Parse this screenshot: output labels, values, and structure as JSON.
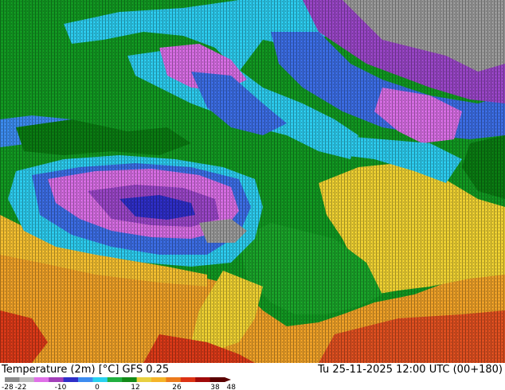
{
  "legend": {
    "title": "Temperature (2m) [°C] GFS 0.25",
    "run_time": "Tu 25-11-2025 12:00 UTC (00+180)",
    "ticks": [
      "-28",
      "-22",
      "-10",
      "0",
      "12",
      "26",
      "38",
      "48"
    ],
    "colors": [
      "#8c8c8c",
      "#bdbdbd",
      "#e070e8",
      "#a23fb8",
      "#2e2ec8",
      "#3c8cf0",
      "#28d2f0",
      "#20b040",
      "#128a18",
      "#e8d040",
      "#f5b428",
      "#ec7a1c",
      "#dc3214",
      "#a00a0a",
      "#5a0000"
    ]
  },
  "map_colors": {
    "green": "#129a22",
    "green_dark": "#0a7c12",
    "cyan": "#2ccdf0",
    "blue": "#3c6ee6",
    "purple": "#9a46c8",
    "magenta": "#d96ee6",
    "grey": "#9c9c9c",
    "yellow": "#f0d232",
    "orange": "#f0a228",
    "red": "#dc3a18",
    "texture": "#000000"
  }
}
